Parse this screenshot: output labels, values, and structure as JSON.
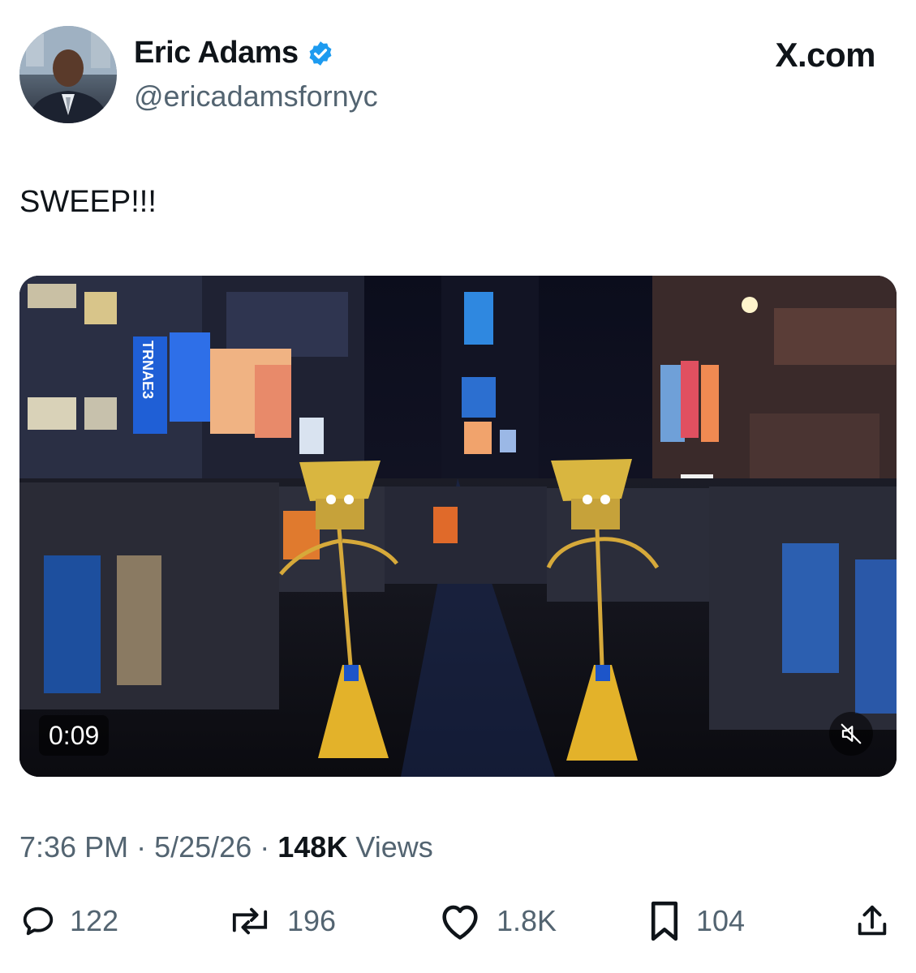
{
  "author": {
    "display_name": "Eric Adams",
    "handle": "@ericadamsfornyc",
    "verified_badge_icon": "verified-check-icon",
    "badge_color": "#1d9bf0"
  },
  "brand_label": "X.com",
  "tweet": {
    "text": "SWEEP!!!"
  },
  "video": {
    "duration": "0:09",
    "mute_icon": "speaker-muted-icon",
    "billboard_text": "TRNAE3"
  },
  "meta": {
    "time": "7:36 PM",
    "separator": "·",
    "date": "5/25/26",
    "views_count": "148K",
    "views_label": "Views"
  },
  "actions": {
    "replies": "122",
    "reposts": "196",
    "likes": "1.8K",
    "bookmarks": "104"
  },
  "colors": {
    "text_primary": "#0f1419",
    "text_secondary": "#536471"
  }
}
